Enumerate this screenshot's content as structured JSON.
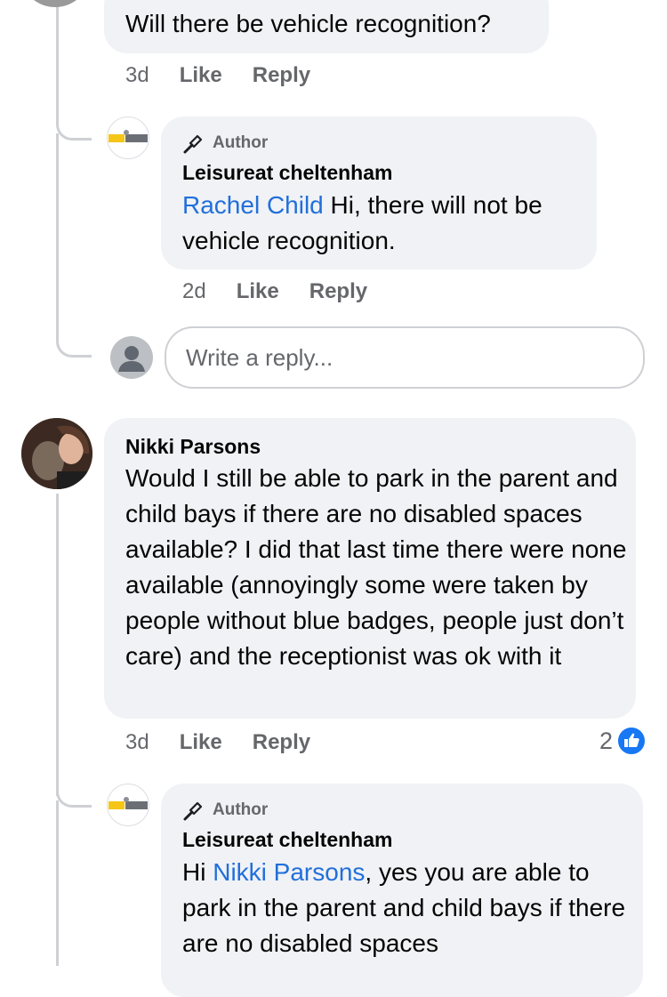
{
  "comment1": {
    "text": "Will there be vehicle recognition?",
    "time": "3d",
    "like": "Like",
    "reply": "Reply"
  },
  "reply1": {
    "badge": "Author",
    "name": "Leisureat cheltenham",
    "mention": "Rachel Child",
    "text": " Hi, there will not be vehicle recognition.",
    "time": "2d",
    "like": "Like",
    "reply": "Reply"
  },
  "write_reply": {
    "placeholder": "Write a reply..."
  },
  "comment2": {
    "name": "Nikki Parsons",
    "text": "Would I still be able to park in the parent and child bays if there are no disabled spaces available? I did that last time there were none available (annoyingly some were taken by people without blue badges, people just don’t care) and the receptionist was ok with it",
    "time": "3d",
    "like": "Like",
    "reply": "Reply",
    "reaction_count": "2"
  },
  "reply2": {
    "badge": "Author",
    "name": "Leisureat cheltenham",
    "prefix": "Hi ",
    "mention": "Nikki Parsons",
    "text": ", yes you are able to park in the parent and child bays if there are no disabled spaces"
  },
  "colors": {
    "mention": "#216fdb",
    "like_reaction": "#1877f2",
    "bubble": "#f0f2f5"
  }
}
